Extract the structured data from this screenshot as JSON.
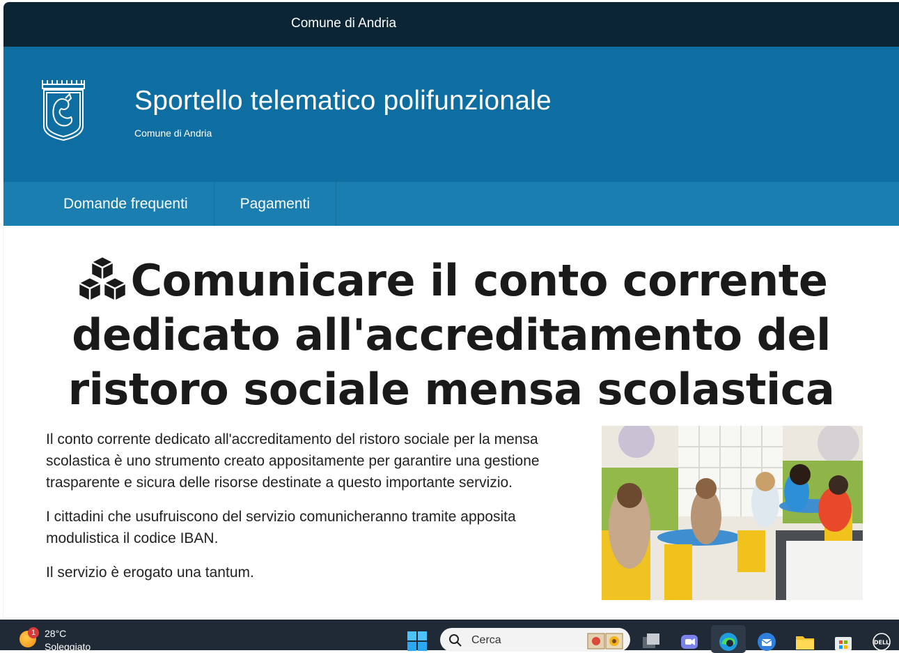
{
  "topbar": {
    "site_link": "Comune di Andria"
  },
  "header": {
    "title": "Sportello telematico polifunzionale",
    "subtitle": "Comune di Andria"
  },
  "nav": {
    "items": [
      {
        "label": "Domande frequenti"
      },
      {
        "label": "Pagamenti"
      }
    ]
  },
  "page": {
    "title_icon": "cubes-icon",
    "title": "Comunicare il conto corrente dedicato all'accreditamento del ristoro sociale mensa scolastica",
    "paragraphs": [
      "Il conto corrente dedicato all'accreditamento del ristoro sociale per la mensa scolastica è uno strumento creato appositamente per garantire una gestione trasparente e sicura delle risorse destinate a questo importante servizio.",
      "I cittadini che usufruiscono del servizio comunicheranno tramite apposita modulistica il codice IBAN.",
      "Il servizio è erogato una tantum."
    ]
  },
  "taskbar": {
    "weather": {
      "temperature": "28°C",
      "condition": "Soleggiato",
      "notification_count": "1"
    },
    "search": {
      "placeholder": "Cerca"
    },
    "icons": [
      "windows-start-icon",
      "task-view-icon",
      "teams-icon",
      "edge-icon",
      "thunderbird-icon",
      "file-explorer-icon",
      "store-icon",
      "dell-icon"
    ]
  },
  "colors": {
    "topbar": "#0c2535",
    "header": "#0f6ea1",
    "navbar": "#1b7eb0",
    "taskbar": "#1f2a36"
  }
}
